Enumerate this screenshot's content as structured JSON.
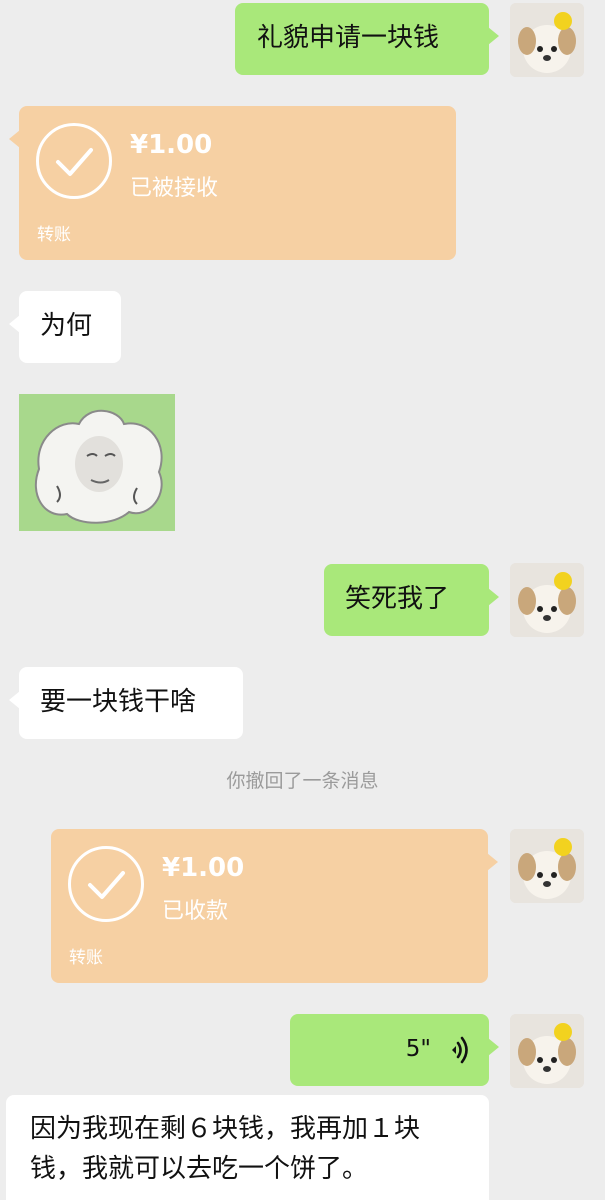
{
  "messages": {
    "m1": {
      "text": "礼貌申请一块钱"
    },
    "t1": {
      "amount": "¥1.00",
      "status": "已被接收",
      "label": "转账"
    },
    "m2": {
      "text": "为何"
    },
    "m3": {
      "text": "笑死我了"
    },
    "m4": {
      "text": "要一块钱干啥"
    },
    "system": {
      "text": "你撤回了一条消息"
    },
    "t2": {
      "amount": "¥1.00",
      "status": "已收款",
      "label": "转账"
    },
    "voice": {
      "duration": "5\""
    },
    "m5": {
      "text": "因为我现在剩６块钱，我再加１块钱，我就可以去吃一个饼了。"
    }
  },
  "colors": {
    "sent_bubble": "#a9e87a",
    "received_bubble": "#ffffff",
    "transfer_card": "#f6d0a3",
    "background": "#ededed"
  },
  "icons": {
    "avatar": "puppy-avatar",
    "sticker": "fluffy-sheep-sticker",
    "check": "check-icon",
    "voice": "voice-wave-icon"
  }
}
